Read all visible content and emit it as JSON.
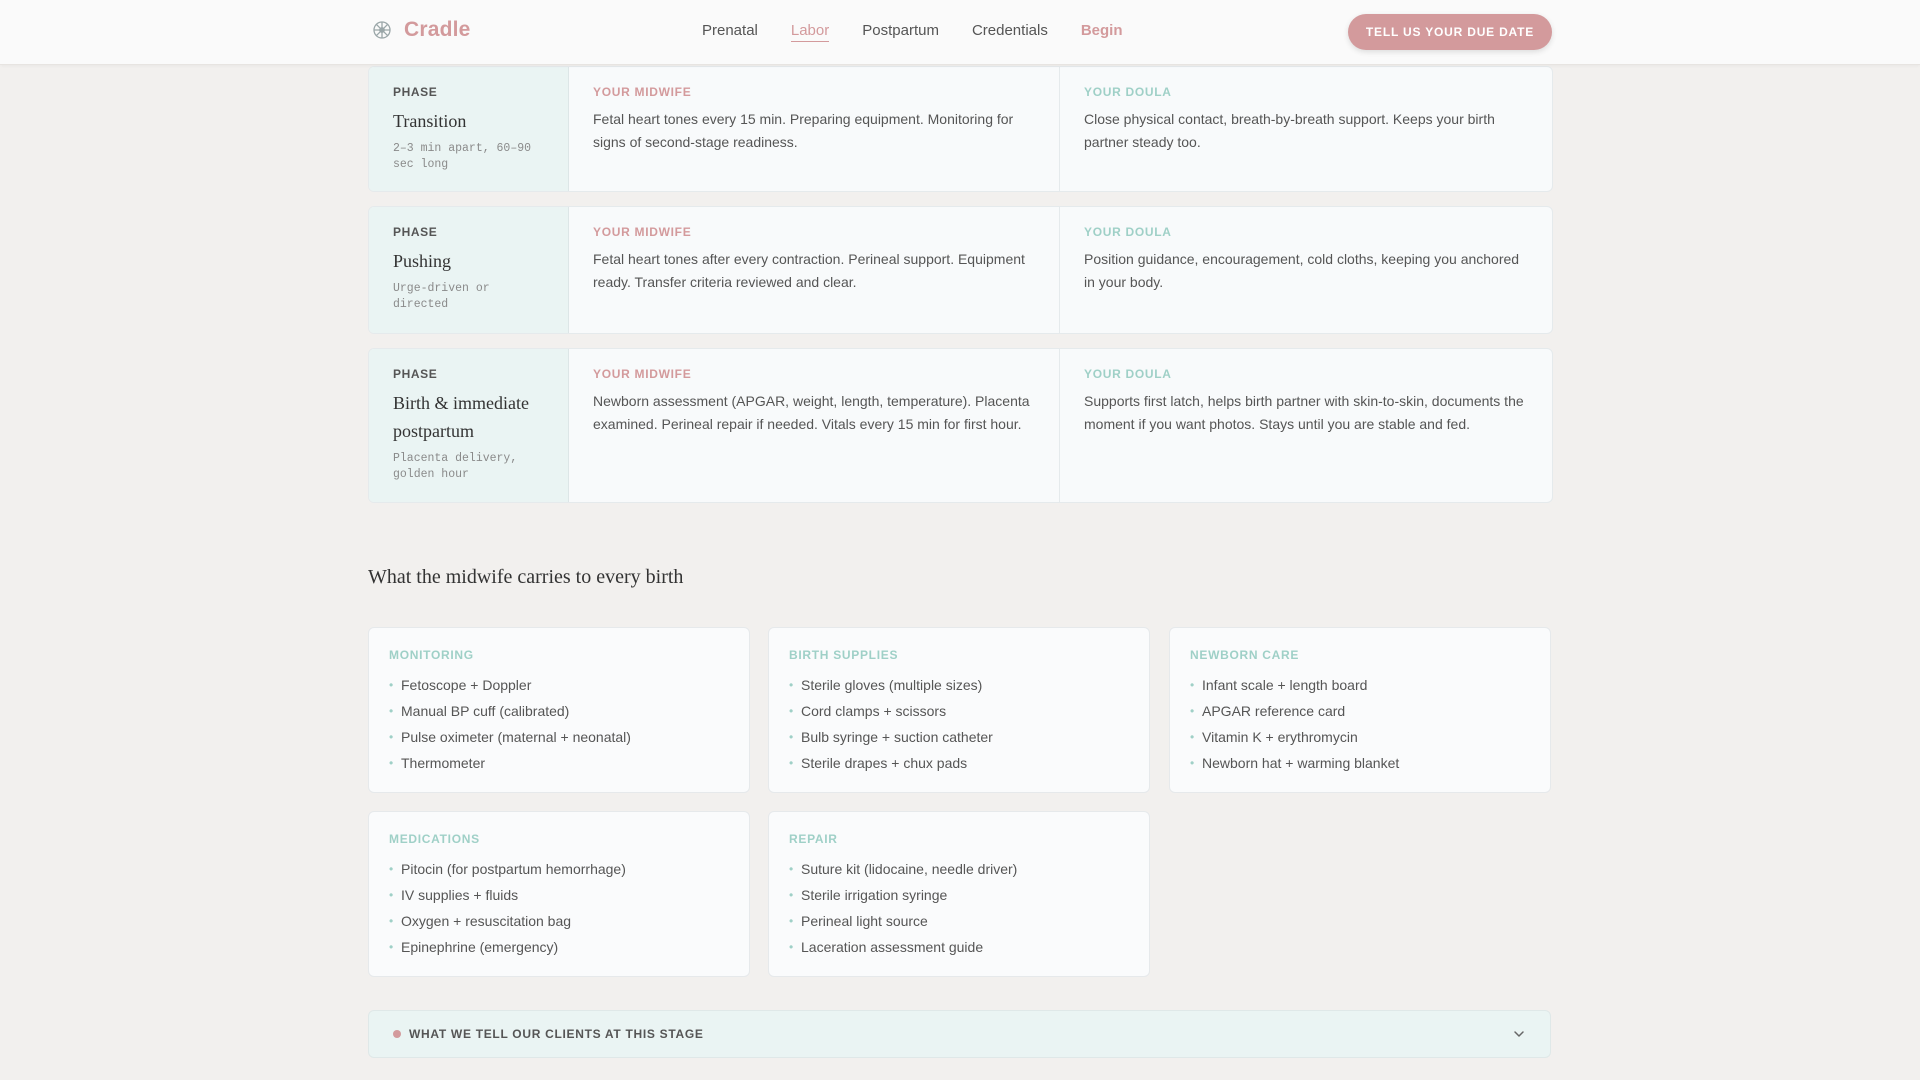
{
  "header": {
    "brand": "Cradle",
    "nav": [
      {
        "label": "Prenatal"
      },
      {
        "label": "Labor"
      },
      {
        "label": "Postpartum"
      },
      {
        "label": "Credentials"
      },
      {
        "label": "Begin"
      }
    ],
    "cta_label": "TELL US YOUR DUE DATE"
  },
  "phases": [
    {
      "label": "PHASE",
      "name": "Transition",
      "meta": "2–3 min apart, 60–90 sec long",
      "midwife_title": "YOUR MIDWIFE",
      "midwife_text": "Fetal heart tones every 15 min. Preparing equipment. Monitoring for signs of second-stage readiness.",
      "doula_title": "YOUR DOULA",
      "doula_text": "Close physical contact, breath-by-breath support. Keeps your birth partner steady too."
    },
    {
      "label": "PHASE",
      "name": "Pushing",
      "meta": "Urge-driven or directed",
      "midwife_title": "YOUR MIDWIFE",
      "midwife_text": "Fetal heart tones after every contraction. Perineal support. Equipment ready. Transfer criteria reviewed and clear.",
      "doula_title": "YOUR DOULA",
      "doula_text": "Position guidance, encouragement, cold cloths, keeping you anchored in your body."
    },
    {
      "label": "PHASE",
      "name": "Birth & immediate postpartum",
      "meta": "Placenta delivery, golden hour",
      "midwife_title": "YOUR MIDWIFE",
      "midwife_text": "Newborn assessment (APGAR, weight, length, temperature). Placenta examined. Perineal repair if needed. Vitals every 15 min for first hour.",
      "doula_title": "YOUR DOULA",
      "doula_text": "Supports first latch, helps birth partner with skin-to-skin, documents the moment if you want photos. Stays until you are stable and fed."
    }
  ],
  "supplies": {
    "heading": "What the midwife carries to every birth",
    "cards": [
      {
        "title": "MONITORING",
        "items": [
          "Fetoscope + Doppler",
          "Manual BP cuff (calibrated)",
          "Pulse oximeter (maternal + neonatal)",
          "Thermometer"
        ]
      },
      {
        "title": "BIRTH SUPPLIES",
        "items": [
          "Sterile gloves (multiple sizes)",
          "Cord clamps + scissors",
          "Bulb syringe + suction catheter",
          "Sterile drapes + chux pads"
        ]
      },
      {
        "title": "NEWBORN CARE",
        "items": [
          "Infant scale + length board",
          "APGAR reference card",
          "Vitamin K + erythromycin",
          "Newborn hat + warming blanket"
        ]
      },
      {
        "title": "MEDICATIONS",
        "items": [
          "Pitocin (for postpartum hemorrhage)",
          "IV supplies + fluids",
          "Oxygen + resuscitation bag",
          "Epinephrine (emergency)"
        ]
      },
      {
        "title": "REPAIR",
        "items": [
          "Suture kit (lidocaine, needle driver)",
          "Sterile irrigation syringe",
          "Perineal light source",
          "Laceration assessment guide"
        ]
      }
    ]
  },
  "accordion": {
    "label": "WHAT WE TELL OUR CLIENTS AT THIS STAGE"
  },
  "colors": {
    "accent_rose": "#d39a9c",
    "accent_mint": "#9fd0c7",
    "background": "#f2f0ee"
  }
}
